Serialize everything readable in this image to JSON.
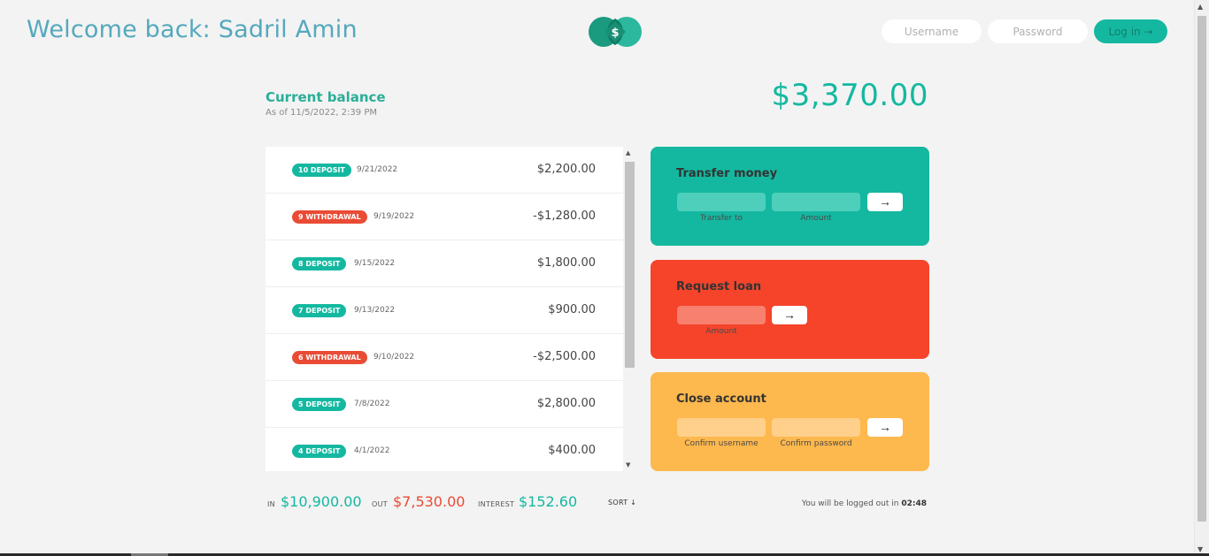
{
  "nav": {
    "welcome": "Welcome back: Sadril Amin",
    "username_placeholder": "Username",
    "password_placeholder": "Password",
    "login_label": "Log in →",
    "logo_symbol": "$"
  },
  "balance": {
    "label": "Current balance",
    "date": "As of 11/5/2022, 2:39 PM",
    "value": "$3,370.00"
  },
  "movements": [
    {
      "type_label": "10 DEPOSIT",
      "kind": "deposit",
      "date": "9/21/2022",
      "amount": "$2,200.00"
    },
    {
      "type_label": "9 WITHDRAWAL",
      "kind": "withdrawal",
      "date": "9/19/2022",
      "amount": "-$1,280.00"
    },
    {
      "type_label": "8 DEPOSIT",
      "kind": "deposit",
      "date": "9/15/2022",
      "amount": "$1,800.00"
    },
    {
      "type_label": "7 DEPOSIT",
      "kind": "deposit",
      "date": "9/13/2022",
      "amount": "$900.00"
    },
    {
      "type_label": "6 WITHDRAWAL",
      "kind": "withdrawal",
      "date": "9/10/2022",
      "amount": "-$2,500.00"
    },
    {
      "type_label": "5 DEPOSIT",
      "kind": "deposit",
      "date": "7/8/2022",
      "amount": "$2,800.00"
    },
    {
      "type_label": "4 DEPOSIT",
      "kind": "deposit",
      "date": "4/1/2022",
      "amount": "$400.00"
    }
  ],
  "operations": {
    "transfer": {
      "title": "Transfer money",
      "to_label": "Transfer to",
      "amount_label": "Amount",
      "button": "→"
    },
    "loan": {
      "title": "Request loan",
      "amount_label": "Amount",
      "button": "→"
    },
    "close": {
      "title": "Close account",
      "user_label": "Confirm username",
      "pin_label": "Confirm password",
      "button": "→"
    }
  },
  "summary": {
    "in_label": "IN",
    "in_value": "$10,900.00",
    "out_label": "OUT",
    "out_value": "$7,530.00",
    "interest_label": "INTEREST",
    "interest_value": "$152.60",
    "sort_label": "SORT ↓",
    "logout_text": "You will be logged out in",
    "timer": "02:48"
  },
  "colors": {
    "deposit": "#14b8a0",
    "withdrawal": "#e94b34",
    "transfer_card": "#14b8a0",
    "loan_card": "#f5442a",
    "close_card": "#fdb84e"
  }
}
